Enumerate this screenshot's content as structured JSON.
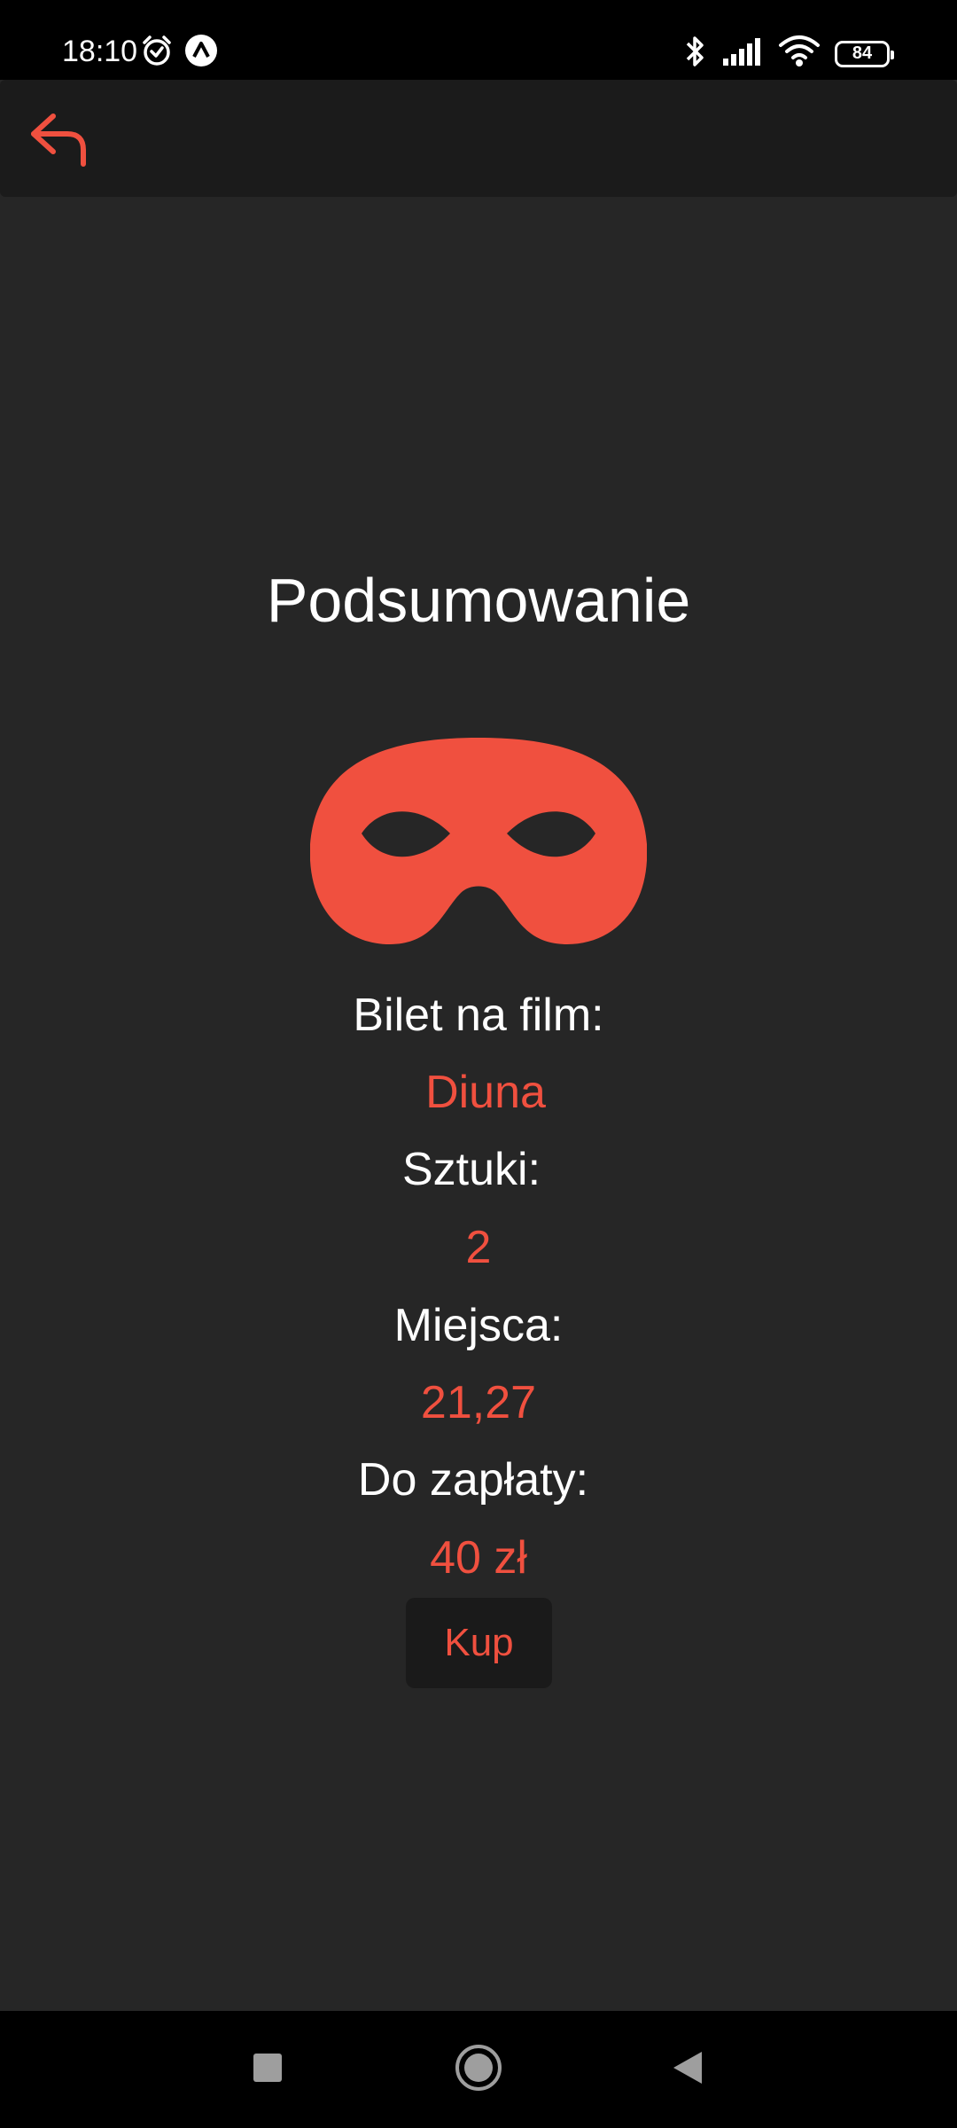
{
  "status_bar": {
    "time": "18:10",
    "battery": "84",
    "icons": [
      "alarm-icon",
      "app-notification-icon",
      "bluetooth-icon",
      "signal-icon",
      "wifi-icon",
      "battery-icon"
    ]
  },
  "app_bar": {
    "back_icon": "back-arrow-icon"
  },
  "summary": {
    "title": "Podsumowanie",
    "illustration": "mask-icon",
    "movie_label": "Bilet na film:",
    "movie_value": "Diuna",
    "quantity_label": "Sztuki:",
    "quantity_value": "2",
    "seats_label": "Miejsca:",
    "seats_value": "21,27",
    "price_label": "Do zapłaty:",
    "price_value": "40 zł",
    "buy_button": "Kup"
  },
  "nav_bar": {
    "items": [
      "recents-square-icon",
      "home-circle-icon",
      "back-triangle-icon"
    ]
  },
  "colors": {
    "accent": "#f0503f",
    "background": "#262626",
    "app_bar": "#1b1b1b",
    "text": "#ffffff"
  }
}
